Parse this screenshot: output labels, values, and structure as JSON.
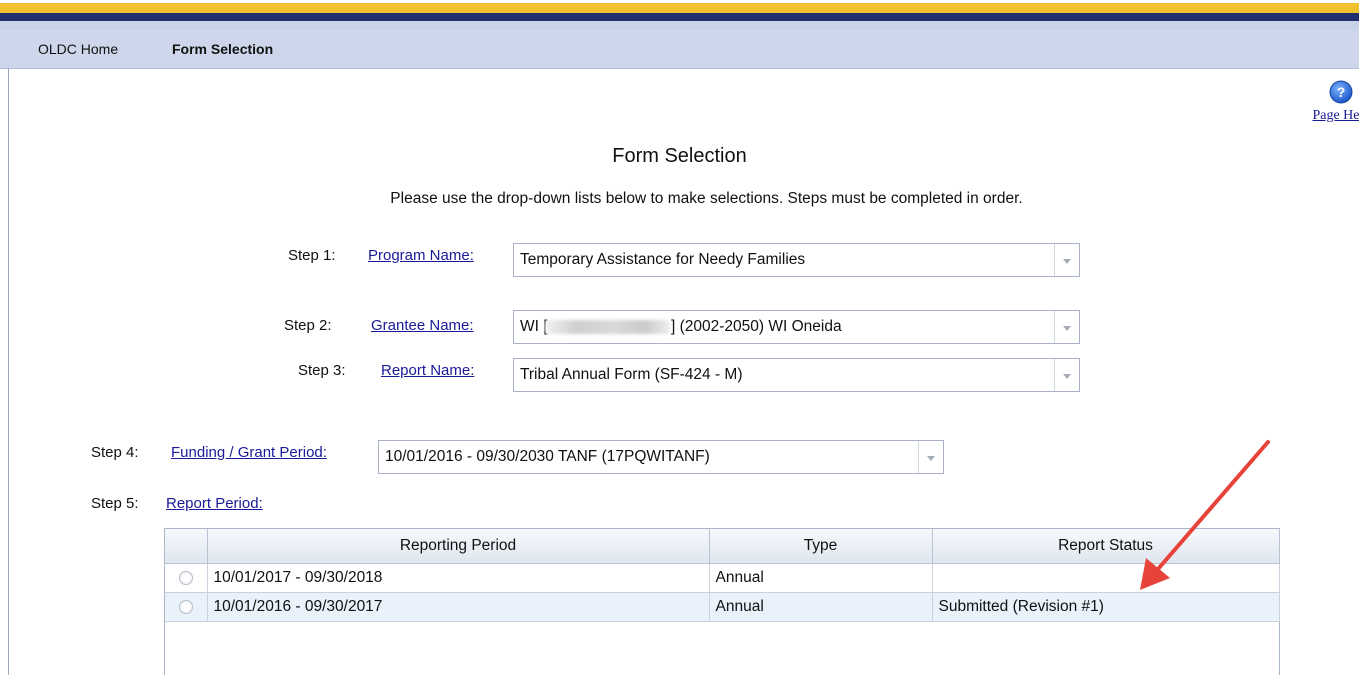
{
  "nav": {
    "home": "OLDC Home",
    "form_selection": "Form Selection"
  },
  "help": {
    "icon": "question-circle-icon",
    "label": "Page He"
  },
  "page": {
    "title": "Form Selection",
    "instructions": "Please use the drop-down lists below to make selections. Steps must be completed in order."
  },
  "steps": {
    "step1": {
      "label": "Step 1:",
      "link": "Program Name:",
      "value": "Temporary Assistance for Needy Families"
    },
    "step2": {
      "label": "Step 2:",
      "link": "Grantee Name:",
      "value_prefix": "WI [",
      "value_suffix": "] (2002-2050) WI Oneida"
    },
    "step3": {
      "label": "Step 3:",
      "link": "Report Name:",
      "value": "Tribal Annual Form (SF-424 - M)"
    },
    "step4": {
      "label": "Step 4:",
      "link": "Funding / Grant Period:",
      "value": "10/01/2016 - 09/30/2030 TANF (17PQWITANF)"
    },
    "step5": {
      "label": "Step 5:",
      "link": "Report Period:"
    }
  },
  "report_grid": {
    "columns": [
      "",
      "Reporting Period",
      "Type",
      "Report Status"
    ],
    "rows": [
      {
        "period": "10/01/2017 - 09/30/2018",
        "type": "Annual",
        "status": ""
      },
      {
        "period": "10/01/2016 - 09/30/2017",
        "type": "Annual",
        "status": "Submitted (Revision #1)"
      }
    ]
  },
  "colors": {
    "header_yellow": "#f2c12e",
    "header_navy": "#1f2f6f",
    "nav_bg": "#cdd6ea",
    "link": "#1a1a99",
    "annotation_arrow": "#e8433a"
  }
}
